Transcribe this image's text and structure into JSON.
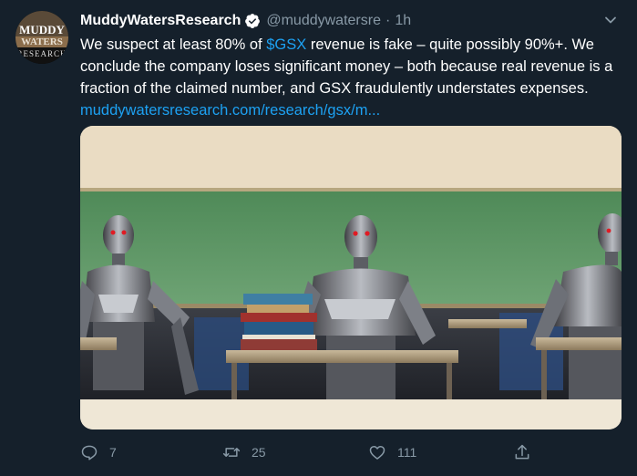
{
  "tweet": {
    "author_name": "MuddyWatersResearch",
    "handle": "@muddywatersre",
    "separator": "·",
    "time": "1h",
    "text_before_cashtag": "We suspect at least 80% of ",
    "cashtag": "$GSX",
    "text_after_cashtag": " revenue is fake – quite possibly 90%+. We conclude the company loses significant money – both because real revenue is a fraction of the claimed number, and GSX fraudulently understates expenses. ",
    "link_text": "muddywatersresearch.com/research/gsx/m...",
    "avatar_text": {
      "line1": "MUDDY",
      "line2": "WATERS",
      "line3": "RESEARCH"
    }
  },
  "actions": {
    "replies": "7",
    "retweets": "25",
    "likes": "111"
  },
  "colors": {
    "background": "#15202b",
    "accent": "#1da1f2",
    "muted": "#8899a6"
  },
  "icons": [
    "verified-badge-icon",
    "chevron-down-icon",
    "reply-icon",
    "retweet-icon",
    "like-icon",
    "share-icon"
  ]
}
